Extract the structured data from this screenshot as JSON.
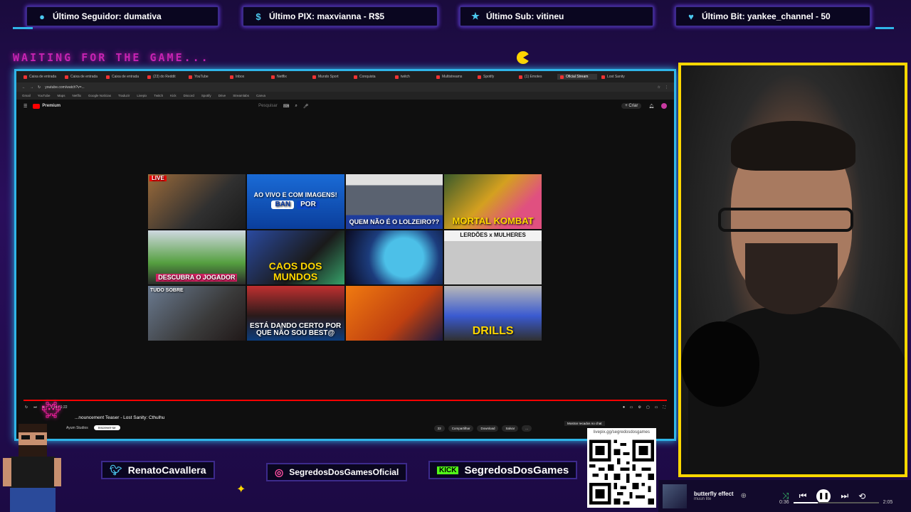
{
  "tickers": [
    {
      "icon": "user-icon",
      "label": "Último Seguidor: dumativa"
    },
    {
      "icon": "dollar-icon",
      "label": "Último PIX: maxvianna - R$5"
    },
    {
      "icon": "star-icon",
      "label": "Último Sub: vitineu"
    },
    {
      "icon": "heart-icon",
      "label": "Último Bit: yankee_channel - 50"
    }
  ],
  "waiting_text": "WAITING FOR THE GAME...",
  "browser": {
    "tabs": [
      "Caixa de entrada",
      "Caixa de entrada",
      "Caixa de entrada",
      "(23) do Reddit",
      "YouTube",
      "Inbox",
      "Netflix",
      "Mundo Sport",
      "Conquista",
      "twitch",
      "Multistreams",
      "Spotify",
      "(1) Emotes",
      "Oficial Stream",
      "Lost Sanity"
    ],
    "active_tab_index": 13,
    "url": "youtube.com/watch?v=...",
    "bookmarks": [
      "Gmail",
      "YouTube",
      "Maps",
      "Netflix",
      "Google Notícias",
      "Traduzir",
      "Livepix",
      "Twitch",
      "Kick",
      "Discord",
      "Spotify",
      "Drive",
      "Streamlabs",
      "Canva"
    ]
  },
  "youtube": {
    "logo": "Premium",
    "search_placeholder": "Pesquisar",
    "create_label": "+ Criar",
    "thumbnails": [
      {
        "text": "LIVE"
      },
      {
        "text": "AO VIVO E COM IMAGENS!",
        "pills": [
          "BAN",
          "POR"
        ]
      },
      {
        "text": "QUEM NÃO É O LOLZEIRO??"
      },
      {
        "text": "MORTAL KOMBAT"
      },
      {
        "text": "DESCUBRA O JOGADOR"
      },
      {
        "text": "CAOS DOS MUNDOS"
      },
      {
        "text": ""
      },
      {
        "text": "LERDÕES x MULHERES"
      },
      {
        "text": "TUDO SOBRE"
      },
      {
        "text": "ESTÁ DANDO CERTO POR QUE NÃO SOU BEST@"
      },
      {
        "text": ""
      },
      {
        "text": "DRILLS"
      }
    ],
    "video_title": "...nouncement Teaser - Lost Sanity: Cthulhu",
    "channel_name": "Ayum Studios",
    "subscribe_label": "Inscrever-se",
    "time": "1:14 / 1:22",
    "progress": 1.0,
    "actions": [
      "33",
      "Compartilhar",
      "Download",
      "Salvar",
      "..."
    ],
    "tooltip": "Mostrar recados no chat"
  },
  "socials": {
    "twitter": "RenatoCavallera",
    "instagram": "SegredosDosGamesOficial",
    "kick_logo": "KICK",
    "kick": "SegredosDosGames"
  },
  "qr_label": "livepix.gg/segredosdosgames",
  "player": {
    "title": "butterfly effect",
    "artist": "muun lite",
    "current": "0:36",
    "total": "2:05",
    "progress": 0.29
  },
  "colors": {
    "accent_cyan": "#2fb5e8",
    "accent_pink": "#ff2bd6",
    "cam_border": "#ffd700"
  }
}
